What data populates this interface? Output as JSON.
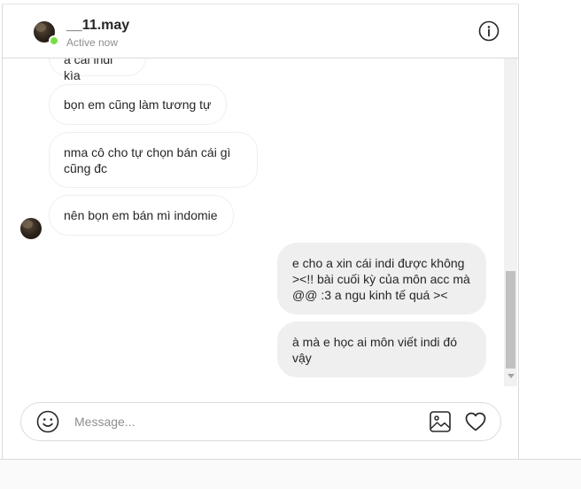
{
  "header": {
    "username": "__11.may",
    "status": "Active now",
    "avatar_icon": "user-avatar",
    "info_icon": "info-icon"
  },
  "messages": [
    {
      "direction": "incoming",
      "text": "à cái indi kìa"
    },
    {
      "direction": "incoming",
      "text": "bọn em cũng làm tương tự"
    },
    {
      "direction": "incoming",
      "text": "nma cô cho tự chọn bán cái gì\ncũng đc"
    },
    {
      "direction": "incoming",
      "text": "nên bọn em bán mì indomie"
    },
    {
      "direction": "outgoing",
      "text": "e cho a xin cái indi được không\n><!! bài cuối kỳ của môn acc mà\n@@ :3 a ngu kinh tế quá ><"
    },
    {
      "direction": "outgoing",
      "text": "à mà e học ai môn viết indi đó\nvậy"
    }
  ],
  "composer": {
    "placeholder": "Message...",
    "value": "",
    "emoji_icon": "emoji-icon",
    "image_icon": "image-icon",
    "like_icon": "heart-icon"
  },
  "colors": {
    "online": "#78de45",
    "outgoing_bubble": "#efefef",
    "border": "#dbdbdb",
    "muted_text": "#8e8e8e"
  }
}
